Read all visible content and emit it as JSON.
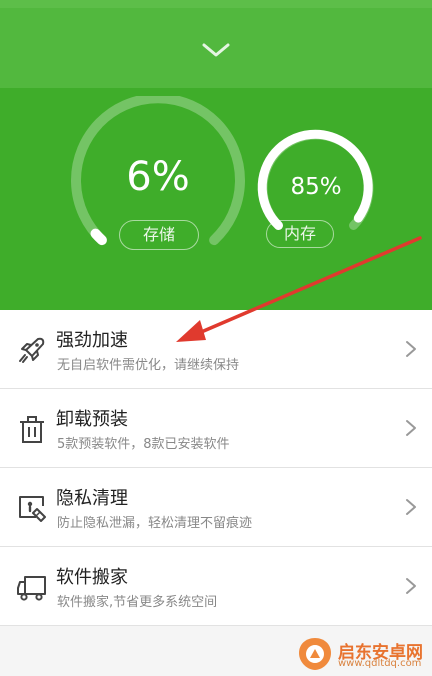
{
  "header": {
    "storage": {
      "value_text": "6%",
      "label": "存储",
      "percent": 6
    },
    "memory": {
      "value_text": "85%",
      "label": "内存",
      "percent": 85
    }
  },
  "items": [
    {
      "title": "强劲加速",
      "subtitle": "无自启软件需优化，请继续保持",
      "icon": "rocket-icon"
    },
    {
      "title": "卸载预装",
      "subtitle": "5款预装软件，8款已安装软件",
      "icon": "trash-icon"
    },
    {
      "title": "隐私清理",
      "subtitle": "防止隐私泄漏，轻松清理不留痕迹",
      "icon": "privacy-clean-icon"
    },
    {
      "title": "软件搬家",
      "subtitle": "软件搬家,节省更多系统空间",
      "icon": "truck-icon"
    }
  ],
  "watermark": {
    "line1": "启东安卓网",
    "line2": "www.qdltdq.com"
  },
  "colors": {
    "green": "#3fad2a",
    "light_green": "#52b83e",
    "arrow_red": "#e03a2e",
    "logo_orange": "#e8732f"
  }
}
